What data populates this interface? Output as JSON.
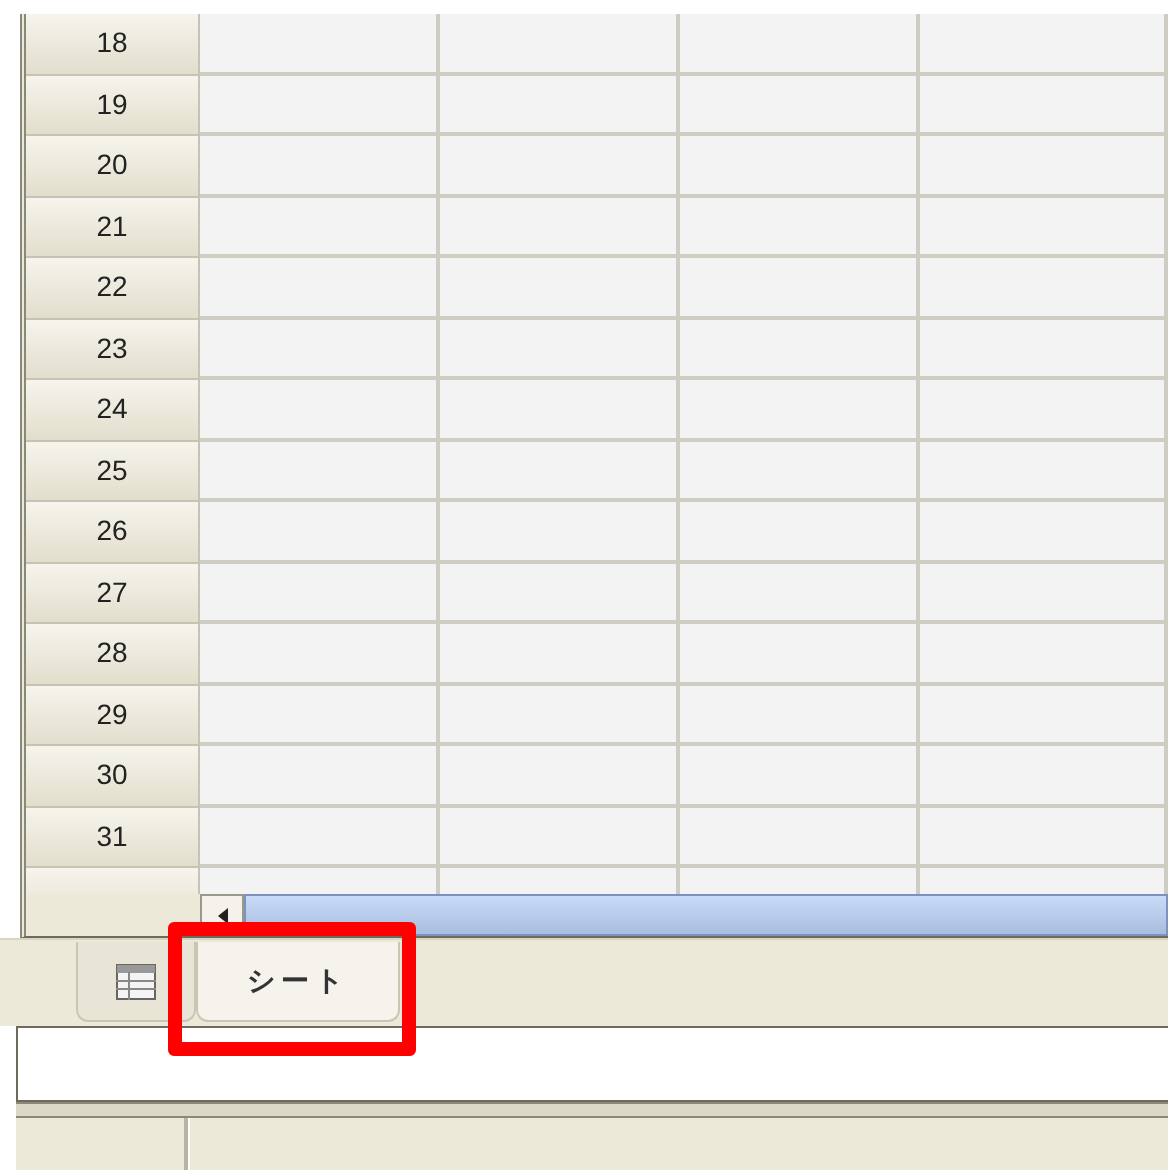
{
  "spreadsheet": {
    "rows": [
      {
        "label": "18"
      },
      {
        "label": "19"
      },
      {
        "label": "20"
      },
      {
        "label": "21"
      },
      {
        "label": "22"
      },
      {
        "label": "23"
      },
      {
        "label": "24"
      },
      {
        "label": "25"
      },
      {
        "label": "26"
      },
      {
        "label": "27"
      },
      {
        "label": "28"
      },
      {
        "label": "29"
      },
      {
        "label": "30"
      },
      {
        "label": "31"
      },
      {
        "label": ""
      }
    ]
  },
  "sheet_tabs": [
    {
      "kind": "icon",
      "selected": false
    },
    {
      "kind": "text",
      "label": "シート",
      "selected": true,
      "highlighted": true
    }
  ]
}
